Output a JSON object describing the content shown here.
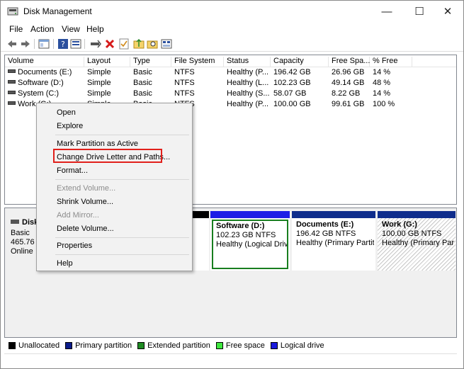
{
  "window": {
    "title": "Disk Management",
    "minimize": "—",
    "maximize": "☐",
    "close": "✕"
  },
  "menu": [
    "File",
    "Action",
    "View",
    "Help"
  ],
  "toolbar_icons": [
    "back-arrow-icon",
    "forward-arrow-icon",
    "show-hide-console-icon",
    "help-icon",
    "properties-icon",
    "connect-icon",
    "delete-icon",
    "check-icon",
    "folder-up-icon",
    "search-icon",
    "view-icon"
  ],
  "columns": [
    "Volume",
    "Layout",
    "Type",
    "File System",
    "Status",
    "Capacity",
    "Free Spa...",
    "% Free"
  ],
  "volumes": [
    [
      "Documents (E:)",
      "Simple",
      "Basic",
      "NTFS",
      "Healthy (P...",
      "196.42 GB",
      "26.96 GB",
      "14 %"
    ],
    [
      "Software (D:)",
      "Simple",
      "Basic",
      "NTFS",
      "Healthy (L...",
      "102.23 GB",
      "49.14 GB",
      "48 %"
    ],
    [
      "System (C:)",
      "Simple",
      "Basic",
      "NTFS",
      "Healthy (S...",
      "58.07 GB",
      "8.22 GB",
      "14 %"
    ],
    [
      "Work (G:)",
      "Simple",
      "Basic",
      "NTFS",
      "Healthy (P...",
      "100.00 GB",
      "99.61 GB",
      "100 %"
    ]
  ],
  "disk": {
    "name": "Disk",
    "type": "Basic",
    "size": "465.76 G",
    "status": "Online"
  },
  "partitions": [
    {
      "name": "Software  (D:)",
      "size": "102.23 GB NTFS",
      "status": "Healthy (Logical Driv"
    },
    {
      "name": "Documents  (E:)",
      "size": "196.42 GB NTFS",
      "status": "Healthy (Primary Partiti"
    },
    {
      "name": "Work  (G:)",
      "size": "100.00 GB NTFS",
      "status": "Healthy (Primary Partit"
    }
  ],
  "context_menu": {
    "open": "Open",
    "explore": "Explore",
    "mark_active": "Mark Partition as Active",
    "change_letter": "Change Drive Letter and Paths...",
    "format": "Format...",
    "extend": "Extend Volume...",
    "shrink": "Shrink Volume...",
    "add_mirror": "Add Mirror...",
    "delete": "Delete Volume...",
    "properties": "Properties",
    "help": "Help"
  },
  "legend": [
    {
      "label": "Unallocated",
      "color": "#000000"
    },
    {
      "label": "Primary partition",
      "color": "#0a1c8a"
    },
    {
      "label": "Extended partition",
      "color": "#1e8b22"
    },
    {
      "label": "Free space",
      "color": "#40e840"
    },
    {
      "label": "Logical drive",
      "color": "#1b1bdc"
    }
  ],
  "colors": {
    "primary_bar": "#0f2d8c",
    "logical_bar": "#1e1ee6",
    "selected_border": "#187e1f",
    "highlight": "#e1201b"
  }
}
